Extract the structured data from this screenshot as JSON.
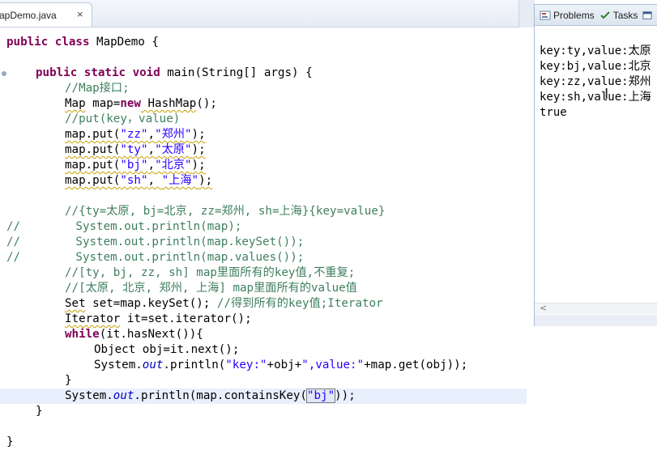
{
  "editor_tab": {
    "label": "apDemo.java",
    "close": "×"
  },
  "view_tabs": [
    {
      "label": "Problems"
    },
    {
      "label": "Tasks"
    }
  ],
  "colors": {
    "keyword": "#7f0055",
    "comment": "#3f7f5f",
    "string": "#2a00ff",
    "field": "#0000c0"
  },
  "code": {
    "l01": {
      "kw1": "public",
      "kw2": "class",
      "rest": " MapDemo {"
    },
    "l02": {
      "kw1": "public",
      "kw2": "static",
      "kw3": "void",
      "rest": " main(String[] args) {"
    },
    "l03": {
      "comment": "//Map接口;"
    },
    "l04": {
      "type": "Map",
      "mid": " map=",
      "kw": "new",
      "call": " HashMap",
      "end": "();"
    },
    "l05": {
      "comment": "//put(key，value)"
    },
    "l06": {
      "pre": "map.put(",
      "s1": "\"zz\"",
      "sep": ",",
      "s2": "\"郑州\"",
      "end": ");"
    },
    "l07": {
      "pre": "map.put(",
      "s1": "\"ty\"",
      "sep": ",",
      "s2": "\"太原\"",
      "end": ");"
    },
    "l08": {
      "pre": "map.put(",
      "s1": "\"bj\"",
      "sep": ",",
      "s2": "\"北京\"",
      "end": ");"
    },
    "l09": {
      "pre": "map.put(",
      "s1": "\"sh\"",
      "sep": ", ",
      "s2": "\"上海\"",
      "end": ");"
    },
    "l10": {
      "comment": "//{ty=太原, bj=北京, zz=郑州, sh=上海}{key=value}"
    },
    "l11": {
      "comment": "//        System.out.println(map);"
    },
    "l12": {
      "comment": "//        System.out.println(map.keySet());"
    },
    "l13": {
      "comment": "//        System.out.println(map.values());"
    },
    "l14": {
      "comment": "//[ty, bj, zz, sh] map里面所有的key值,不重复;"
    },
    "l15": {
      "comment": "//[太原, 北京, 郑州, 上海] map里面所有的value值"
    },
    "l16": {
      "type": "Set",
      "rest": " set=map.keySet(); ",
      "comment": "//得到所有的key值;Iterator"
    },
    "l17": {
      "type": "Iterator",
      "rest": " it=set.iterator();"
    },
    "l18": {
      "kw": "while",
      "rest": "(it.hasNext()){"
    },
    "l19": {
      "text": "Object obj=it.next();"
    },
    "l20": {
      "pre": "System.",
      "field": "out",
      "mid": ".println(",
      "s1": "\"key:\"",
      "mid2": "+obj+",
      "s2": "\",value:\"",
      "end": "+map.get(obj));"
    },
    "l21": {
      "text": "}"
    },
    "l22": {
      "pre": "System.",
      "field": "out",
      "mid": ".println(map.containsKey(",
      "s1": "\"bj\"",
      "end": "));"
    },
    "l23": {
      "text": "}"
    },
    "l24": {
      "text": "}"
    }
  },
  "console_output": [
    "key:ty,value:太原",
    "key:bj,value:北京",
    "key:zz,value:郑州",
    "key:sh,value:上海",
    "true"
  ]
}
